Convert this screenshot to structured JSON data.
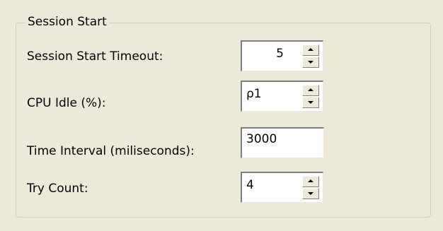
{
  "group": {
    "title": "Session Start"
  },
  "fields": [
    {
      "label": "Session Start Timeout:",
      "value": "5"
    },
    {
      "label": "CPU Idle (%):",
      "value": "ρ1"
    },
    {
      "label": "Time Interval (miliseconds):",
      "value": "3000"
    },
    {
      "label": "Try Count:",
      "value": "4"
    }
  ],
  "icons": {
    "spin_up": "triangle-up-icon",
    "spin_down": "triangle-down-icon"
  },
  "colors": {
    "window_bg": "#ece9d8",
    "groupbox_border": "#d0d0bf",
    "field_bg": "#ffffff"
  }
}
